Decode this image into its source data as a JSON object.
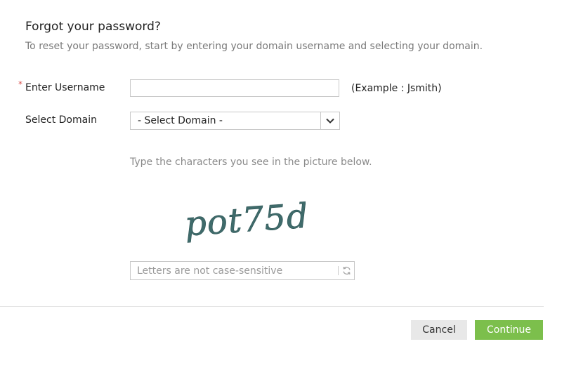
{
  "header": {
    "title": "Forgot your password?",
    "subtitle": "To reset your password, start by entering your domain username and selecting your domain."
  },
  "form": {
    "required_marker": "*",
    "username_label": "Enter Username",
    "username_value": "",
    "username_hint": "(Example : Jsmith)",
    "domain_label": "Select Domain",
    "domain_selected": "- Select Domain -"
  },
  "captcha": {
    "instruction": "Type the characters you see in the picture below.",
    "image_text": "pot75d",
    "image_color": "#3f6b6b",
    "input_placeholder": "Letters are not case-sensitive",
    "input_value": "",
    "refresh_icon": "refresh-icon"
  },
  "footer": {
    "cancel_label": "Cancel",
    "continue_label": "Continue",
    "continue_color": "#7cbf4c"
  }
}
